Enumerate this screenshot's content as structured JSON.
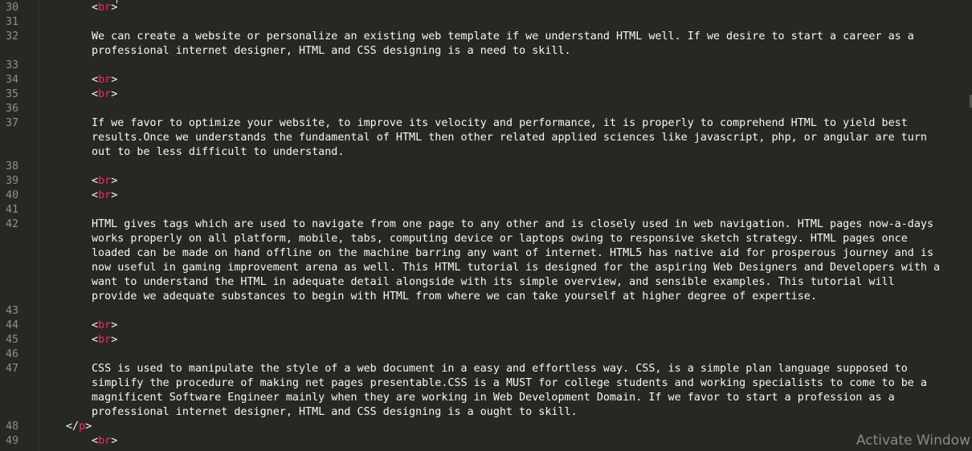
{
  "editor": {
    "lines": [
      {
        "num": "30",
        "kind": "tag",
        "tag": "br"
      },
      {
        "num": "31",
        "kind": "empty"
      },
      {
        "num": "32",
        "kind": "text",
        "rows": [
          "We can create a website or personalize an existing web template if we understand HTML well. If we desire to start a career as a",
          "professional internet designer, HTML and CSS designing is a need to skill."
        ]
      },
      {
        "num": "33",
        "kind": "empty"
      },
      {
        "num": "34",
        "kind": "tag",
        "tag": "br"
      },
      {
        "num": "35",
        "kind": "tag",
        "tag": "br"
      },
      {
        "num": "36",
        "kind": "empty"
      },
      {
        "num": "37",
        "kind": "text",
        "rows": [
          "If we favor to optimize your website, to improve its velocity and performance, it is properly to comprehend HTML to yield best",
          "results.Once we understands the fundamental of HTML then other related applied sciences like javascript, php, or angular are turn",
          "out to be less difficult to understand."
        ]
      },
      {
        "num": "38",
        "kind": "empty"
      },
      {
        "num": "39",
        "kind": "tag",
        "tag": "br"
      },
      {
        "num": "40",
        "kind": "tag",
        "tag": "br"
      },
      {
        "num": "41",
        "kind": "empty"
      },
      {
        "num": "42",
        "kind": "text",
        "rows": [
          "HTML gives tags which are used to navigate from one page to any other and is closely used in web navigation. HTML pages now-a-days",
          "works properly on all platform, mobile, tabs, computing device or laptops owing to responsive sketch strategy. HTML pages once",
          "loaded can be made on hand offline on the machine barring any want of internet. HTML5 has native aid for prosperous journey and is",
          "now useful in gaming improvement arena as well. This HTML tutorial is designed for the aspiring Web Designers and Developers with a",
          "want to understand the HTML in adequate detail alongside with its simple overview, and sensible examples. This tutorial will",
          "provide we adequate substances to begin with HTML from where we can take yourself at higher degree of expertise."
        ]
      },
      {
        "num": "43",
        "kind": "empty"
      },
      {
        "num": "44",
        "kind": "tag",
        "tag": "br"
      },
      {
        "num": "45",
        "kind": "tag",
        "tag": "br"
      },
      {
        "num": "46",
        "kind": "empty"
      },
      {
        "num": "47",
        "kind": "text",
        "rows": [
          "CSS is used to manipulate the style of a web document in a easy and effortless way. CSS, is a simple plan language supposed to",
          "simplify the procedure of making net pages presentable.CSS is a MUST for college students and working specialists to come to be a",
          "magnificent Software Engineer mainly when they are working in Web Development Domain. If we favor to start a profession as a",
          "professional internet designer, HTML and CSS designing is a ought to skill."
        ]
      },
      {
        "num": "48",
        "kind": "closetag",
        "tag": "p"
      },
      {
        "num": "49",
        "kind": "tag",
        "tag": "br"
      }
    ]
  },
  "colors": {
    "background": "#272822",
    "text": "#f8f8f2",
    "tag": "#f92672",
    "gutter_text": "#8f908a"
  },
  "watermark": "Activate Window"
}
